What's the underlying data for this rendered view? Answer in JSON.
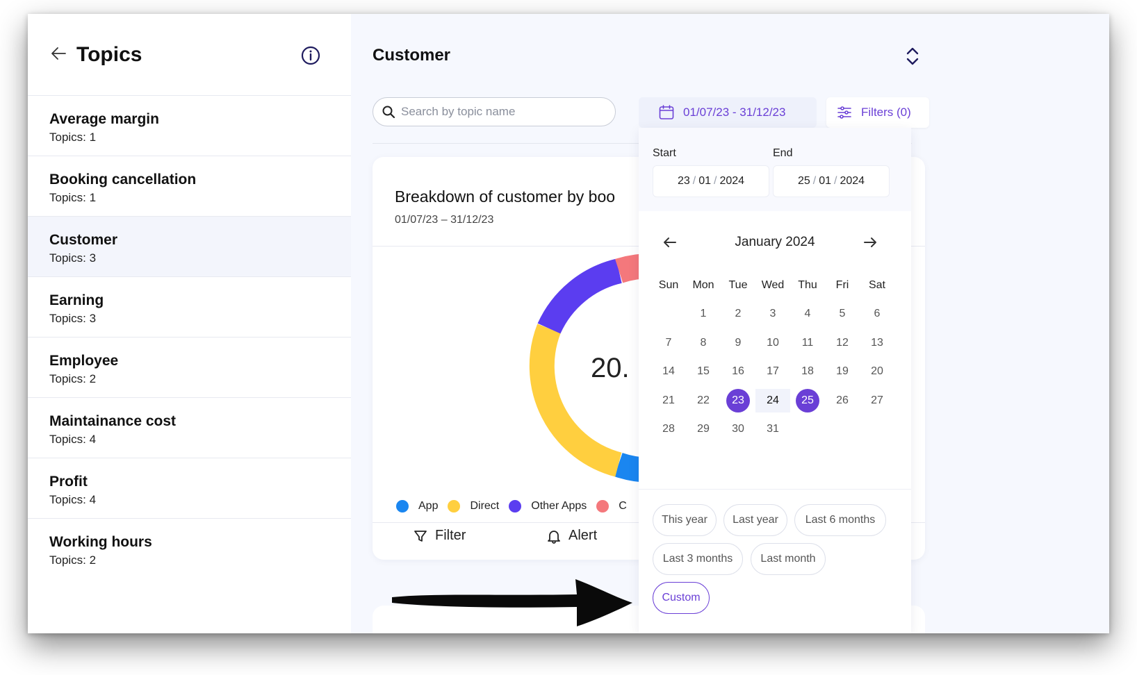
{
  "sidebar": {
    "title": "Topics",
    "items": [
      {
        "name": "Average margin",
        "count": "Topics: 1"
      },
      {
        "name": "Booking cancellation",
        "count": "Topics: 1"
      },
      {
        "name": "Customer",
        "count": "Topics: 3"
      },
      {
        "name": "Earning",
        "count": "Topics: 3"
      },
      {
        "name": "Employee",
        "count": "Topics: 2"
      },
      {
        "name": "Maintainance cost",
        "count": "Topics: 4"
      },
      {
        "name": "Profit",
        "count": "Topics: 4"
      },
      {
        "name": "Working hours",
        "count": "Topics: 2"
      }
    ],
    "active_index": 2
  },
  "main": {
    "title": "Customer",
    "search": {
      "placeholder": "Search by topic name",
      "value": ""
    },
    "date_range_label": "01/07/23 - 31/12/23",
    "filters_label": "Filters (0)"
  },
  "card": {
    "title": "Breakdown of customer by boo",
    "subtitle": "01/07/23 – 31/12/23",
    "center_value": "20.",
    "legend": [
      {
        "label": "App",
        "color": "#1a86f0"
      },
      {
        "label": "Direct",
        "color": "#ffcf3f"
      },
      {
        "label": "Other Apps",
        "color": "#5b3df0"
      },
      {
        "label": "C",
        "color": "#f4787c"
      }
    ],
    "actions": {
      "filter": "Filter",
      "alert": "Alert"
    }
  },
  "picker": {
    "start_label": "Start",
    "end_label": "End",
    "start": {
      "day": "23",
      "month": "01",
      "year": "2024"
    },
    "end": {
      "day": "25",
      "month": "01",
      "year": "2024"
    },
    "month_label": "January 2024",
    "weekdays": [
      "Sun",
      "Mon",
      "Tue",
      "Wed",
      "Thu",
      "Fri",
      "Sat"
    ],
    "weeks": [
      [
        "",
        "1",
        "2",
        "3",
        "4",
        "5",
        "6"
      ],
      [
        "7",
        "8",
        "9",
        "10",
        "11",
        "12",
        "13"
      ],
      [
        "14",
        "15",
        "16",
        "17",
        "18",
        "19",
        "20"
      ],
      [
        "21",
        "22",
        "23",
        "24",
        "25",
        "26",
        "27"
      ],
      [
        "28",
        "29",
        "30",
        "31",
        "",
        "",
        ""
      ]
    ],
    "selected_start": "23",
    "selected_end": "25",
    "presets": [
      "This year",
      "Last year",
      "Last 6 months",
      "Last 3 months",
      "Last month",
      "Custom"
    ],
    "active_preset": "Custom"
  },
  "colors": {
    "accent": "#6a3fd6"
  }
}
